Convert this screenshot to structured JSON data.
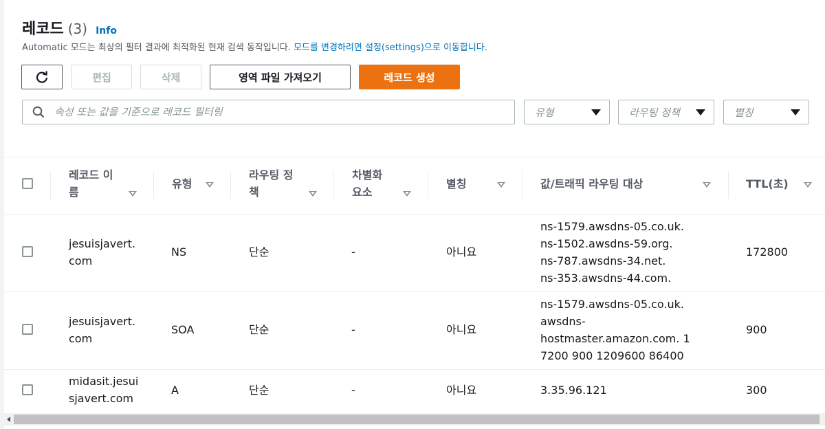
{
  "header": {
    "title": "레코드",
    "count": "(3)",
    "info": "Info",
    "desc_text": "Automatic 모드는 최상의 필터 결과에 최적화된 현재 검색 동작입니다. ",
    "desc_link": "모드를 변경하려면 설정(settings)으로 이동합니다."
  },
  "toolbar": {
    "edit_label": "편집",
    "delete_label": "삭제",
    "import_label": "영역 파일 가져오기",
    "create_label": "레코드 생성"
  },
  "filters": {
    "search_placeholder": "속성 또는 값을 기준으로 레코드 필터링",
    "type": "유형",
    "routing": "라우팅 정책",
    "alias": "별칭"
  },
  "columns": {
    "name_1": "레코드 이",
    "name_2": "름",
    "type": "유형",
    "routing_1": "라우팅 정",
    "routing_2": "책",
    "diff_1": "차별화",
    "diff_2": "요소",
    "alias": "별칭",
    "value": "값/트래픽 라우팅 대상",
    "ttl": "TTL(초)"
  },
  "records": [
    {
      "name_1": "jesuisjavert.",
      "name_2": "com",
      "type": "NS",
      "routing": "단순",
      "diff": "-",
      "alias": "아니요",
      "value": [
        "ns-1579.awsdns-05.co.uk.",
        "ns-1502.awsdns-59.org.",
        "ns-787.awsdns-34.net.",
        "ns-353.awsdns-44.com."
      ],
      "ttl": "172800"
    },
    {
      "name_1": "jesuisjavert.",
      "name_2": "com",
      "type": "SOA",
      "routing": "단순",
      "diff": "-",
      "alias": "아니요",
      "value": [
        "ns-1579.awsdns-05.co.uk.",
        "awsdns-",
        "hostmaster.amazon.com. 1",
        "7200 900 1209600 86400"
      ],
      "ttl": "900"
    },
    {
      "name_1": "midasit.jesui",
      "name_2": "sjavert.com",
      "type": "A",
      "routing": "단순",
      "diff": "-",
      "alias": "아니요",
      "value": [
        "3.35.96.121"
      ],
      "ttl": "300"
    }
  ],
  "colors": {
    "primary": "#ec7211",
    "link": "#0073bb"
  }
}
